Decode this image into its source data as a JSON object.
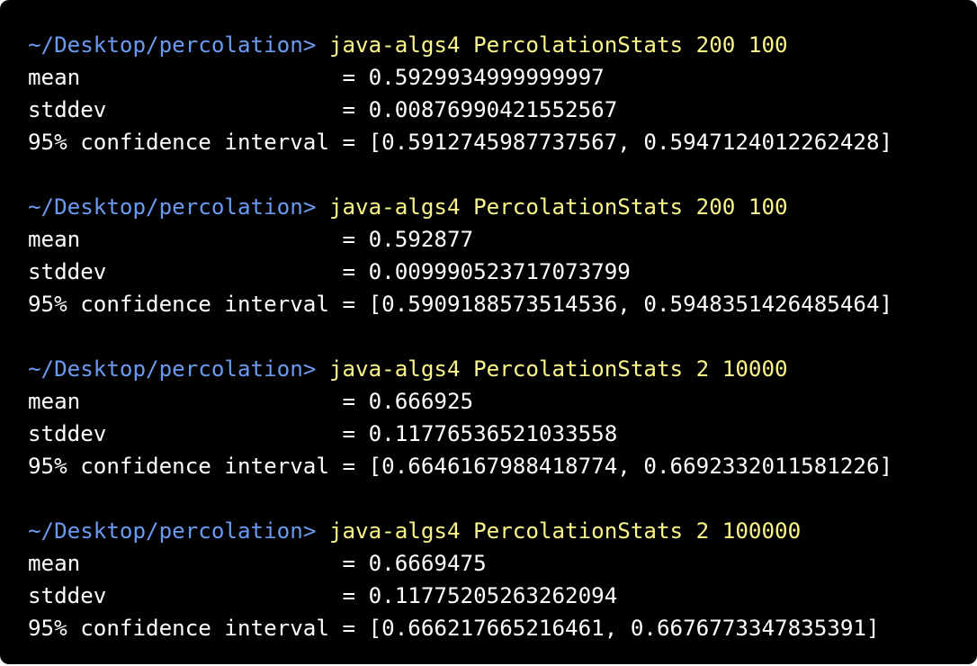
{
  "terminal": {
    "prompt_path": "~/Desktop/percolation",
    "prompt_symbol": "> ",
    "runs": [
      {
        "command": "java-algs4 PercolationStats 200 100",
        "mean_line": "mean                    = 0.5929934999999997",
        "stddev_line": "stddev                  = 0.00876990421552567",
        "ci_line": "95% confidence interval = [0.5912745987737567, 0.5947124012262428]"
      },
      {
        "command": "java-algs4 PercolationStats 200 100",
        "mean_line": "mean                    = 0.592877",
        "stddev_line": "stddev                  = 0.009990523717073799",
        "ci_line": "95% confidence interval = [0.5909188573514536, 0.5948351426485464]"
      },
      {
        "command": "java-algs4 PercolationStats 2 10000",
        "mean_line": "mean                    = 0.666925",
        "stddev_line": "stddev                  = 0.11776536521033558",
        "ci_line": "95% confidence interval = [0.6646167988418774, 0.6692332011581226]"
      },
      {
        "command": "java-algs4 PercolationStats 2 100000",
        "mean_line": "mean                    = 0.6669475",
        "stddev_line": "stddev                  = 0.11775205263262094",
        "ci_line": "95% confidence interval = [0.666217665216461, 0.6676773347835391]"
      }
    ],
    "colors": {
      "background": "#000000",
      "prompt": "#6b9bf0",
      "command": "#fbf58a",
      "output": "#ffffff"
    }
  }
}
